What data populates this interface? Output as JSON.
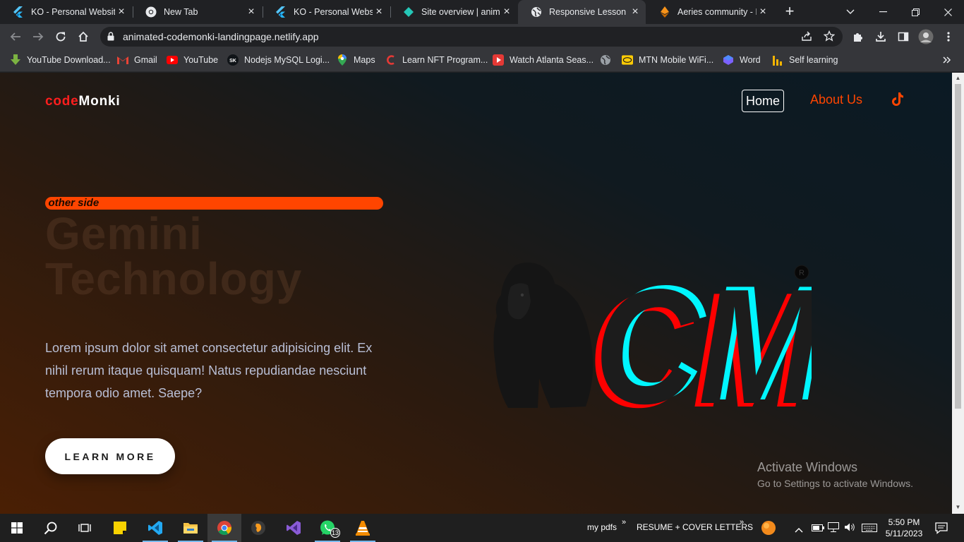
{
  "tabs": [
    {
      "title": "KO - Personal Website",
      "icon": "flutter-icon",
      "active": false
    },
    {
      "title": "New Tab",
      "icon": "chrome-icon",
      "active": false
    },
    {
      "title": "KO - Personal Website",
      "icon": "flutter-icon",
      "active": false
    },
    {
      "title": "Site overview | animat",
      "icon": "netlify-icon",
      "active": false
    },
    {
      "title": "Responsive Lesson",
      "icon": "globe-icon",
      "active": true
    },
    {
      "title": "Aeries community - H",
      "icon": "ethereum-icon",
      "active": false
    }
  ],
  "address_bar": {
    "url": "animated-codemonki-landingpage.netlify.app"
  },
  "bookmarks": [
    {
      "label": "YouTube Download...",
      "icon": "download-arrow-icon"
    },
    {
      "label": "Gmail",
      "icon": "gmail-icon"
    },
    {
      "label": "YouTube",
      "icon": "youtube-icon"
    },
    {
      "label": "Nodejs MySQL Logi...",
      "icon": "sk-icon"
    },
    {
      "label": "Maps",
      "icon": "maps-pin-icon"
    },
    {
      "label": "Learn NFT Program...",
      "icon": "c-logo-icon"
    },
    {
      "label": "Watch Atlanta Seas...",
      "icon": "play-icon"
    },
    {
      "label": "",
      "icon": "globe-icon"
    },
    {
      "label": "MTN Mobile WiFi...",
      "icon": "mtn-icon"
    },
    {
      "label": "Word",
      "icon": "word-icon"
    },
    {
      "label": "Self learning",
      "icon": "chart-bars-icon"
    }
  ],
  "site": {
    "logo_part1": "code",
    "logo_part2": "Monki",
    "nav": {
      "home": "Home",
      "about": "About Us"
    },
    "marquee_text": "e other side",
    "hero_title_line1": "Gemini",
    "hero_title_line2": "Technology",
    "hero_body": "Lorem ipsum dolor sit amet consectetur adipisicing elit. Ex nihil rerum itaque quisquam! Natus repudiandae nesciunt tempora odio amet. Saepe?",
    "cta_label": "LEARN MORE",
    "art_letters": "CM",
    "art_mark": "R",
    "colors": {
      "accent_red": "#ff1e1e",
      "accent_orange": "#ff4500",
      "cyan": "#00f0ff"
    }
  },
  "watermark": {
    "line1": "Activate Windows",
    "line2": "Go to Settings to activate Windows."
  },
  "taskbar": {
    "folder1": "my pdfs",
    "folder2": "RESUME + COVER LETTERS",
    "whatsapp_badge": "13",
    "time": "5:50 PM",
    "date": "5/11/2023"
  }
}
